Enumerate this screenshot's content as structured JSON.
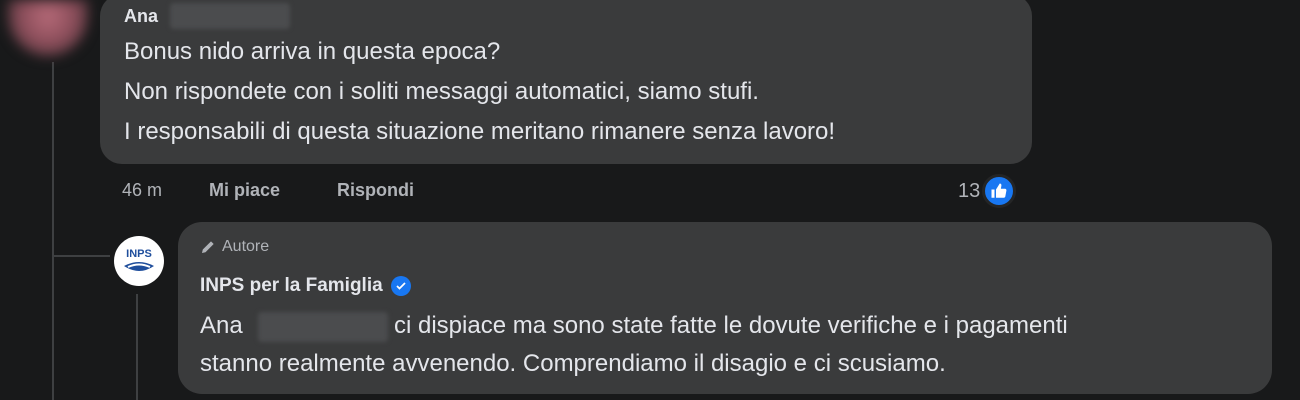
{
  "comment": {
    "author": "Ana",
    "lines": [
      "Bonus nido arriva in questa epoca?",
      "Non rispondete con i soliti messaggi automatici, siamo stufi.",
      "I responsabili di questa situazione meritano rimanere senza lavoro!"
    ],
    "time": "46 m",
    "like_label": "Mi piace",
    "reply_label": "Rispondi",
    "reaction_count": "13",
    "reaction_icon": "like-thumb-icon"
  },
  "reply": {
    "badge_label": "Autore",
    "badge_icon": "pencil-icon",
    "page_name": "INPS per la Famiglia",
    "verified_icon": "verified-badge-icon",
    "mention": "Ana",
    "line1_rest": "ci dispiace ma sono state fatte le dovute verifiche e i pagamenti",
    "line2": "stanno realmente avvenendo. Comprendiamo il disagio e ci scusiamo.",
    "avatar_text": "INPS"
  },
  "colors": {
    "background": "#18191a",
    "bubble": "#3a3b3c",
    "text": "#e4e6eb",
    "muted": "#b0b3b8",
    "accent": "#1877f2"
  }
}
